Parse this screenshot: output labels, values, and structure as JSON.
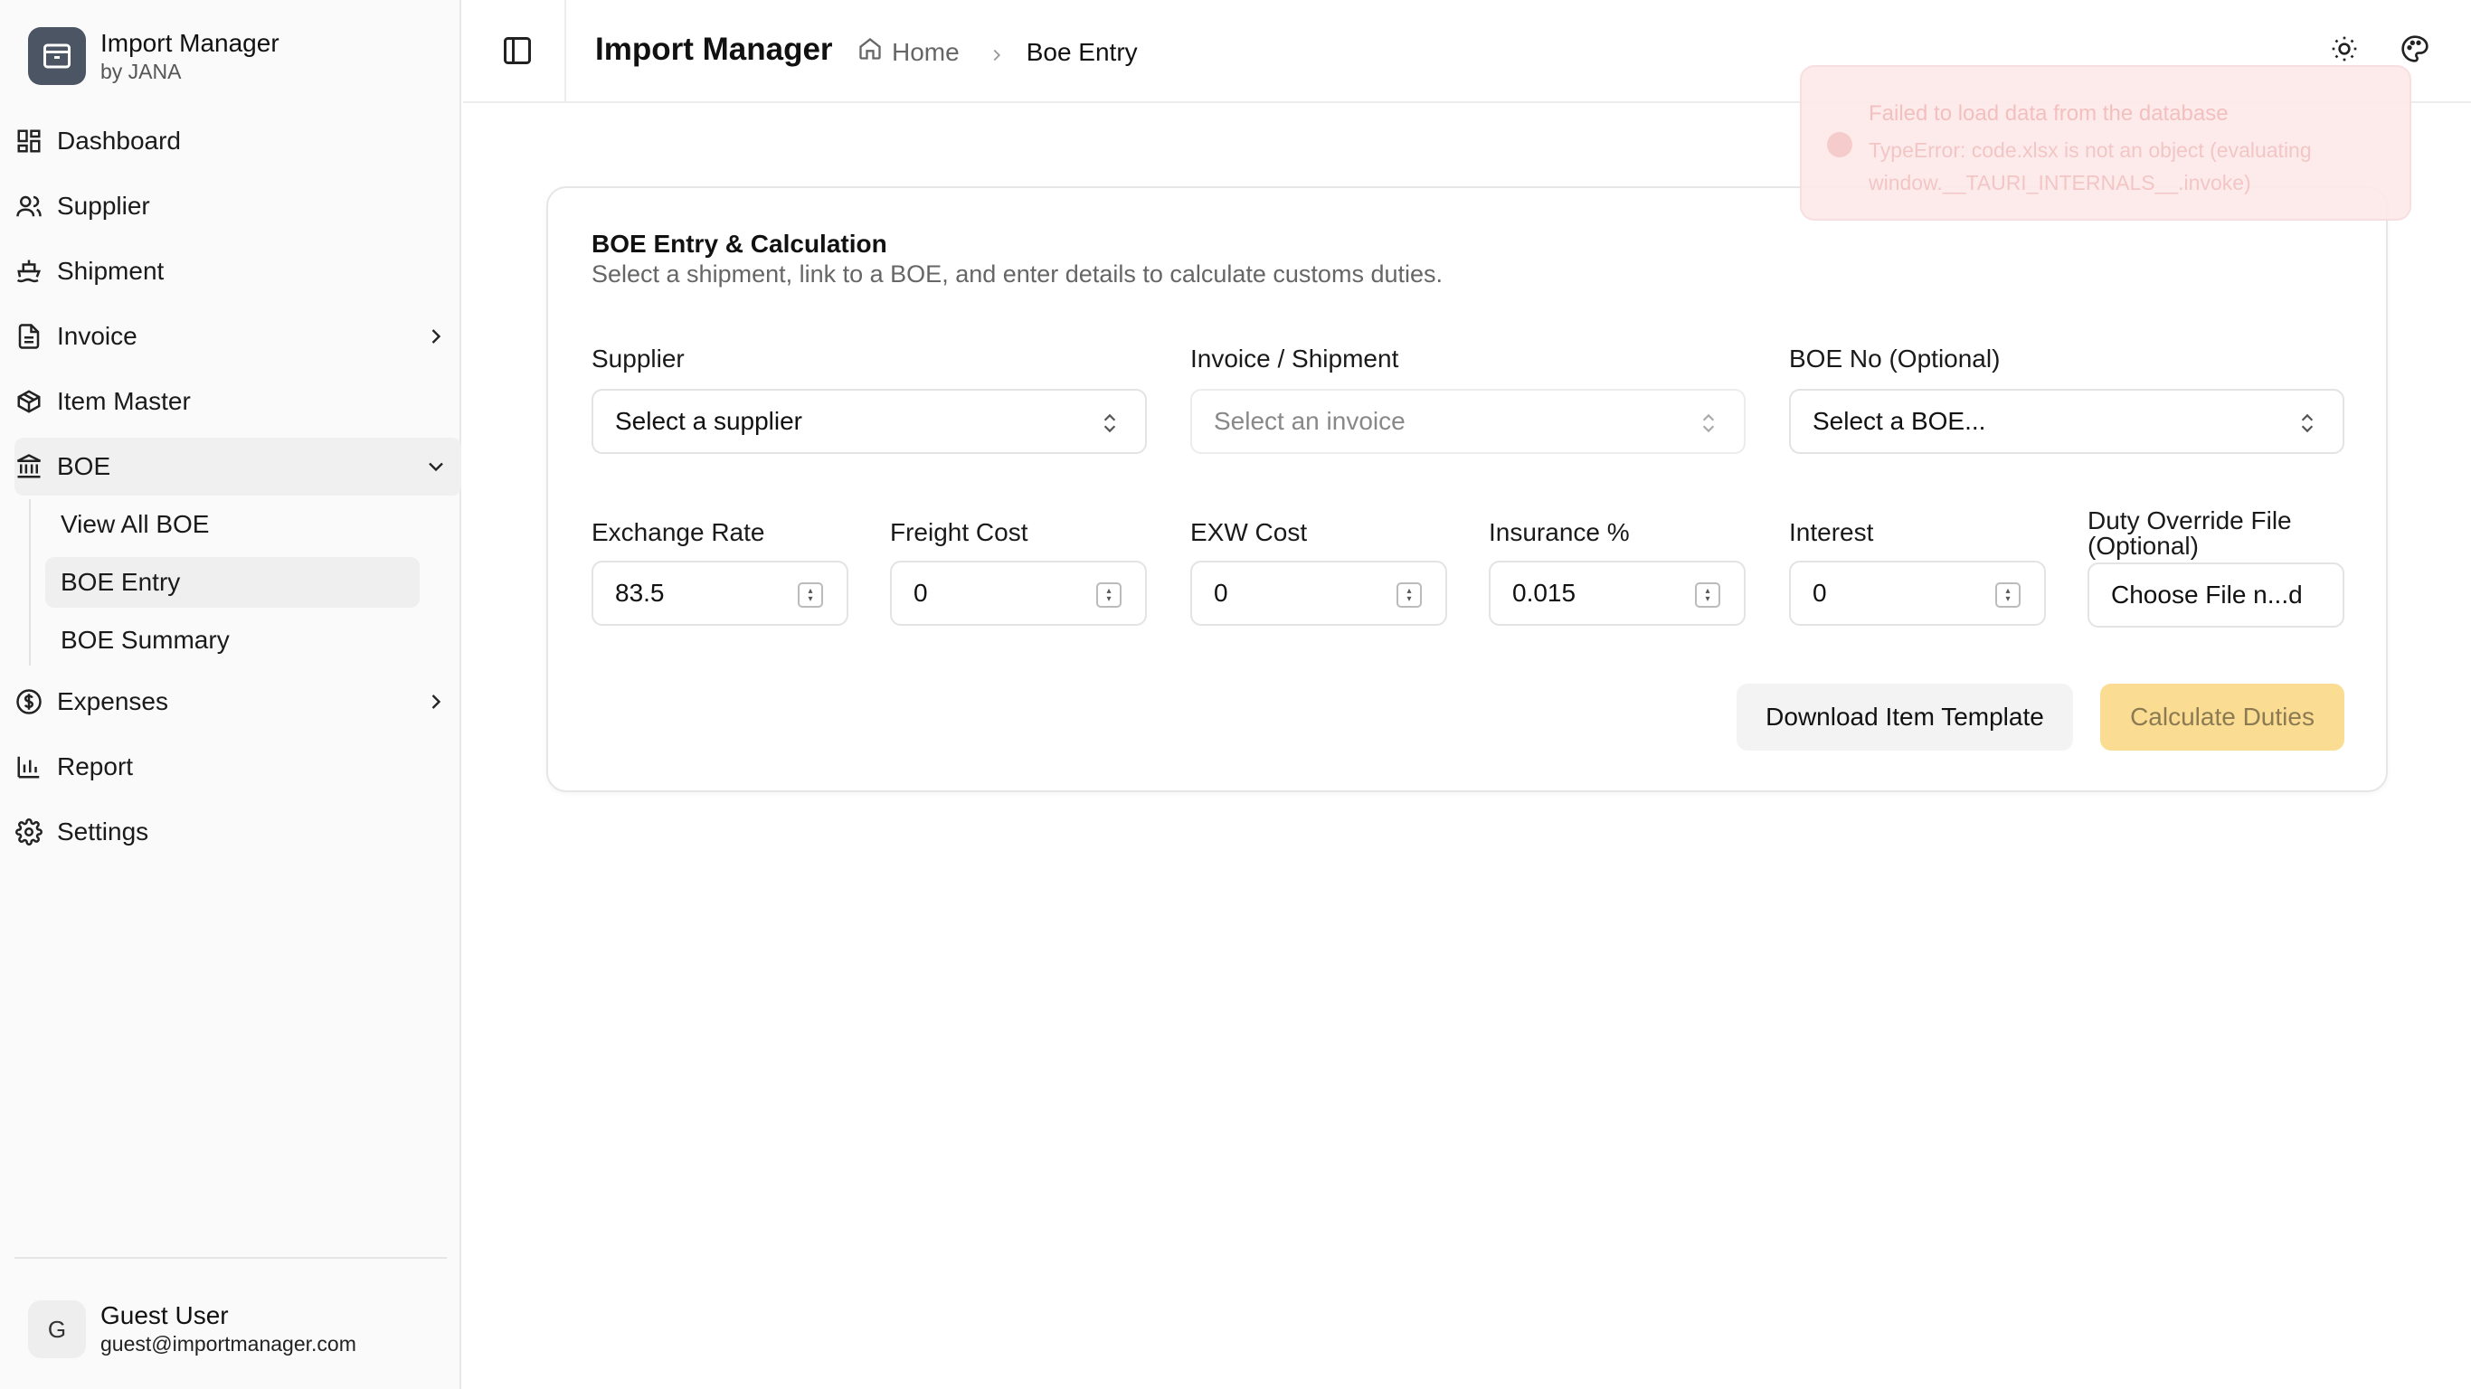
{
  "brand": {
    "title": "Import Manager",
    "subtitle": "by JANA"
  },
  "sidebar": {
    "items": [
      {
        "label": "Dashboard",
        "icon": "dashboard-icon"
      },
      {
        "label": "Supplier",
        "icon": "users-icon"
      },
      {
        "label": "Shipment",
        "icon": "ship-icon"
      },
      {
        "label": "Invoice",
        "icon": "file-icon"
      },
      {
        "label": "Item Master",
        "icon": "package-icon"
      },
      {
        "label": "BOE",
        "icon": "landmark-icon"
      },
      {
        "label": "Expenses",
        "icon": "dollar-circle-icon"
      },
      {
        "label": "Report",
        "icon": "bar-chart-icon"
      },
      {
        "label": "Settings",
        "icon": "gear-icon"
      }
    ],
    "boe_sub": [
      "View All BOE",
      "BOE Entry",
      "BOE Summary"
    ]
  },
  "user": {
    "initial": "G",
    "name": "Guest User",
    "email": "guest@importmanager.com"
  },
  "header": {
    "title": "Import Manager",
    "breadcrumb_home": "Home",
    "breadcrumb_current": "Boe Entry"
  },
  "card": {
    "title": "BOE Entry & Calculation",
    "description": "Select a shipment, link to a BOE, and enter details to calculate customs duties.",
    "supplier_label": "Supplier",
    "supplier_value": "Select a supplier",
    "invoice_label": "Invoice / Shipment",
    "invoice_value": "Select an invoice",
    "boe_label": "BOE No (Optional)",
    "boe_value": "Select a BOE...",
    "exchange_label": "Exchange Rate",
    "exchange_value": "83.5",
    "freight_label": "Freight Cost",
    "freight_value": "0",
    "exw_label": "EXW Cost",
    "exw_value": "0",
    "insurance_label": "Insurance %",
    "insurance_value": "0.015",
    "interest_label": "Interest",
    "interest_value": "0",
    "duty_label_1": "Duty Override File",
    "duty_label_2": "(Optional)",
    "duty_value": "Choose File n...d",
    "download_btn": "Download Item Template",
    "calculate_btn": "Calculate Duties"
  },
  "toast": {
    "title": "Failed to load data from the database",
    "message": "TypeError: code.xlsx is not an object (evaluating window.__TAURI_INTERNALS__.invoke)"
  },
  "colors": {
    "accent": "#fadd92",
    "toast_bg": "#fdeaea",
    "sidebar_bg": "#fafafa"
  }
}
